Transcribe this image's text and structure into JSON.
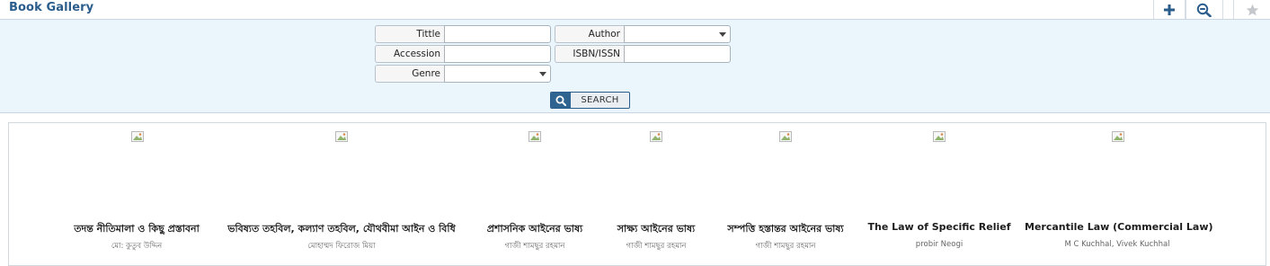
{
  "header": {
    "title": "Book Gallery",
    "actions": [
      {
        "name": "add",
        "icon": "plus-icon"
      },
      {
        "name": "zoom-out",
        "icon": "zoom-out-icon"
      },
      {
        "name": "favorite",
        "icon": "star-icon"
      }
    ]
  },
  "filters": {
    "title_label": "Tittle",
    "title_value": "",
    "author_label": "Author",
    "author_value": "",
    "accession_label": "Accession No.",
    "accession_value": "",
    "isbn_label": "ISBN/ISSN",
    "isbn_value": "",
    "genre_label": "Genre",
    "genre_value": "",
    "search_label": "SEARCH",
    "search_icon": "search-icon"
  },
  "books": [
    {
      "title": "তদন্ত নীতিমালা ও কিছু প্রস্তাবনা",
      "author": "মো: কুতুব উদ্দিন"
    },
    {
      "title": "ভবিষ্যত তহবিল, কল্যাণ তহবিল, যৌথবীমা আইন ও বিধি",
      "author": "মোহাম্মদ ফিরোজ মিয়া"
    },
    {
      "title": "প্রশাসনিক আইনের ভাষ্য",
      "author": "গাজী শামছুর রহমান"
    },
    {
      "title": "সাক্ষ্য আইনের ভাষ্য",
      "author": "গাজী শামছুর রহমান"
    },
    {
      "title": "সম্পত্তি হস্তান্তর আইনের ভাষ্য",
      "author": "গাজী শামছুর রহমান"
    },
    {
      "title": "The Law of Specific Relief",
      "author": "probir Neogi"
    },
    {
      "title": "Mercantile Law (Commercial Law)",
      "author": "M C Kuchhal, Vivek Kuchhal"
    }
  ],
  "colors": {
    "accent": "#2b5d8c",
    "panel_bg": "#eaf5fc"
  }
}
